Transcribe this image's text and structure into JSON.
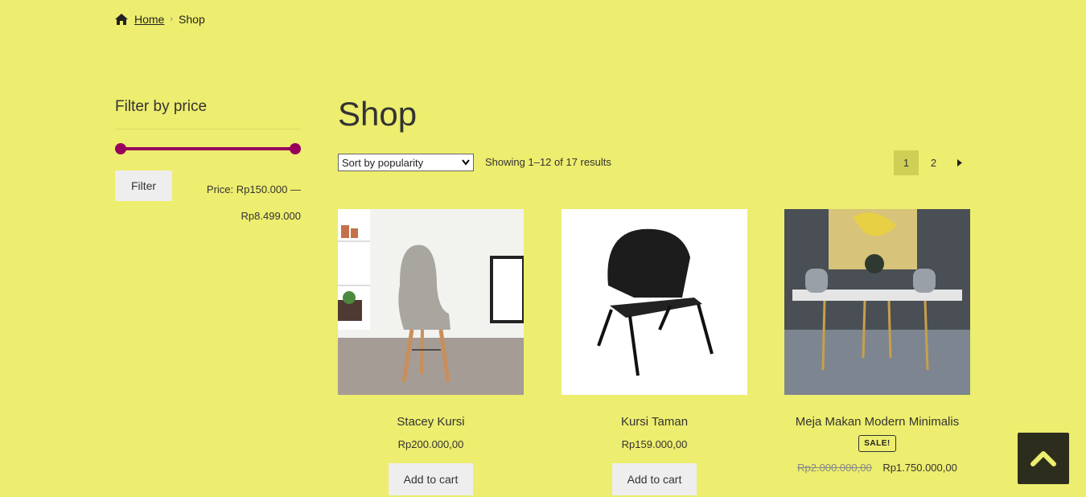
{
  "breadcrumb": {
    "home": "Home",
    "current": "Shop",
    "separator": "›"
  },
  "sidebar": {
    "title": "Filter by price",
    "filter_button": "Filter",
    "price_line1": "Price: Rp150.000 —",
    "price_line2": "Rp8.499.000",
    "slider_range": [
      0,
      1
    ]
  },
  "main": {
    "title": "Shop",
    "sort": {
      "selected": "Sort by popularity"
    },
    "result_count": "Showing 1–12 of 17 results",
    "pagination": {
      "pages": [
        "1",
        "2"
      ],
      "current": "1"
    }
  },
  "products": [
    {
      "name": "Stacey Kursi",
      "price": "Rp200.000,00",
      "button": "Add to cart"
    },
    {
      "name": "Kursi Taman",
      "price": "Rp159.000,00",
      "button": "Add to cart"
    },
    {
      "name": "Meja Makan Modern Minimalis",
      "badge": "SALE!",
      "old_price": "Rp2.000.000,00",
      "sale_price": "Rp1.750.000,00"
    }
  ],
  "colors": {
    "background": "#eded6f",
    "accent": "#96005c",
    "button_bg": "#eeeeee",
    "back_to_top_bg": "#2d2d1e"
  },
  "icons": {
    "home": "home-icon",
    "next": "caret-right-icon",
    "back_to_top": "chevron-up-icon",
    "sort": "chevron-down-icon"
  }
}
